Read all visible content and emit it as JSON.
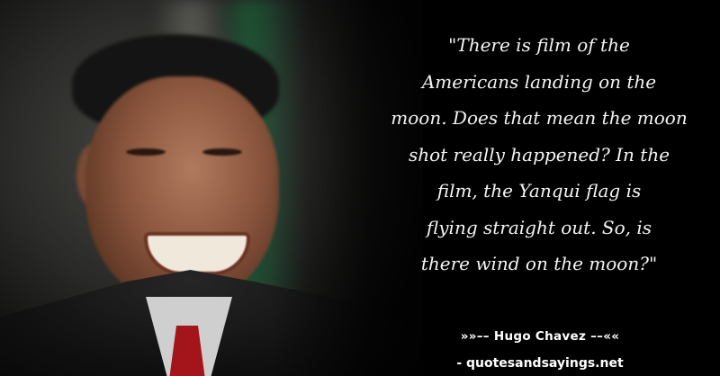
{
  "quote": {
    "lines": [
      "\"There is film of the",
      "Americans landing on the",
      "moon. Does that mean the moon",
      "shot really happened? In the",
      "film, the Yanqui flag is",
      "flying straight out. So, is",
      "there wind on the moon?\""
    ]
  },
  "author_line": "»»–– Hugo Chavez ––««",
  "source_line": "- quotesandsayings.net",
  "colors": {
    "background": "#000000",
    "text": "#f4f4f4"
  }
}
